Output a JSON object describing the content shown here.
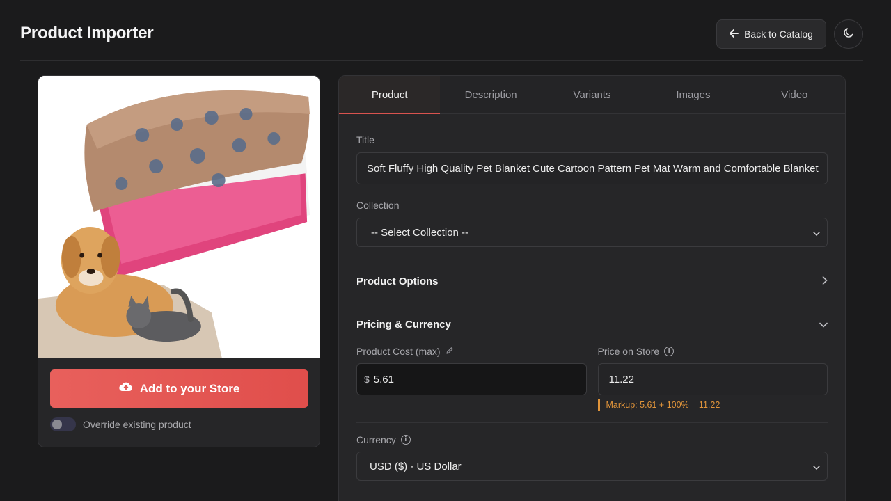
{
  "header": {
    "title": "Product Importer",
    "back_label": "Back to Catalog",
    "back_icon": "arrow-left-icon",
    "theme_icon": "moon-icon"
  },
  "product": {
    "image_description": "pet blanket with dog and cat",
    "add_button_label": "Add to your Store",
    "add_button_icon": "cloud-upload-icon",
    "override_label": "Override existing product",
    "override_enabled": false
  },
  "tabs": [
    {
      "label": "Product",
      "active": true
    },
    {
      "label": "Description",
      "active": false
    },
    {
      "label": "Variants",
      "active": false
    },
    {
      "label": "Images",
      "active": false
    },
    {
      "label": "Video",
      "active": false
    }
  ],
  "form": {
    "title_label": "Title",
    "title_value": "Soft Fluffy High Quality Pet Blanket Cute Cartoon Pattern Pet Mat Warm and Comfortable Blanket",
    "collection_label": "Collection",
    "collection_value": "-- Select Collection --",
    "product_options_label": "Product Options",
    "pricing_label": "Pricing & Currency",
    "cost_label": "Product Cost (max)",
    "cost_currency": "$",
    "cost_value": "5.61",
    "store_price_label": "Price on Store",
    "store_price_value": "11.22",
    "markup_note": "Markup: 5.61 + 100% = 11.22",
    "currency_label": "Currency",
    "currency_value": "USD ($) - US Dollar"
  },
  "colors": {
    "accent": "#e0504d",
    "warning": "#e0943a",
    "background": "#1b1b1c"
  }
}
